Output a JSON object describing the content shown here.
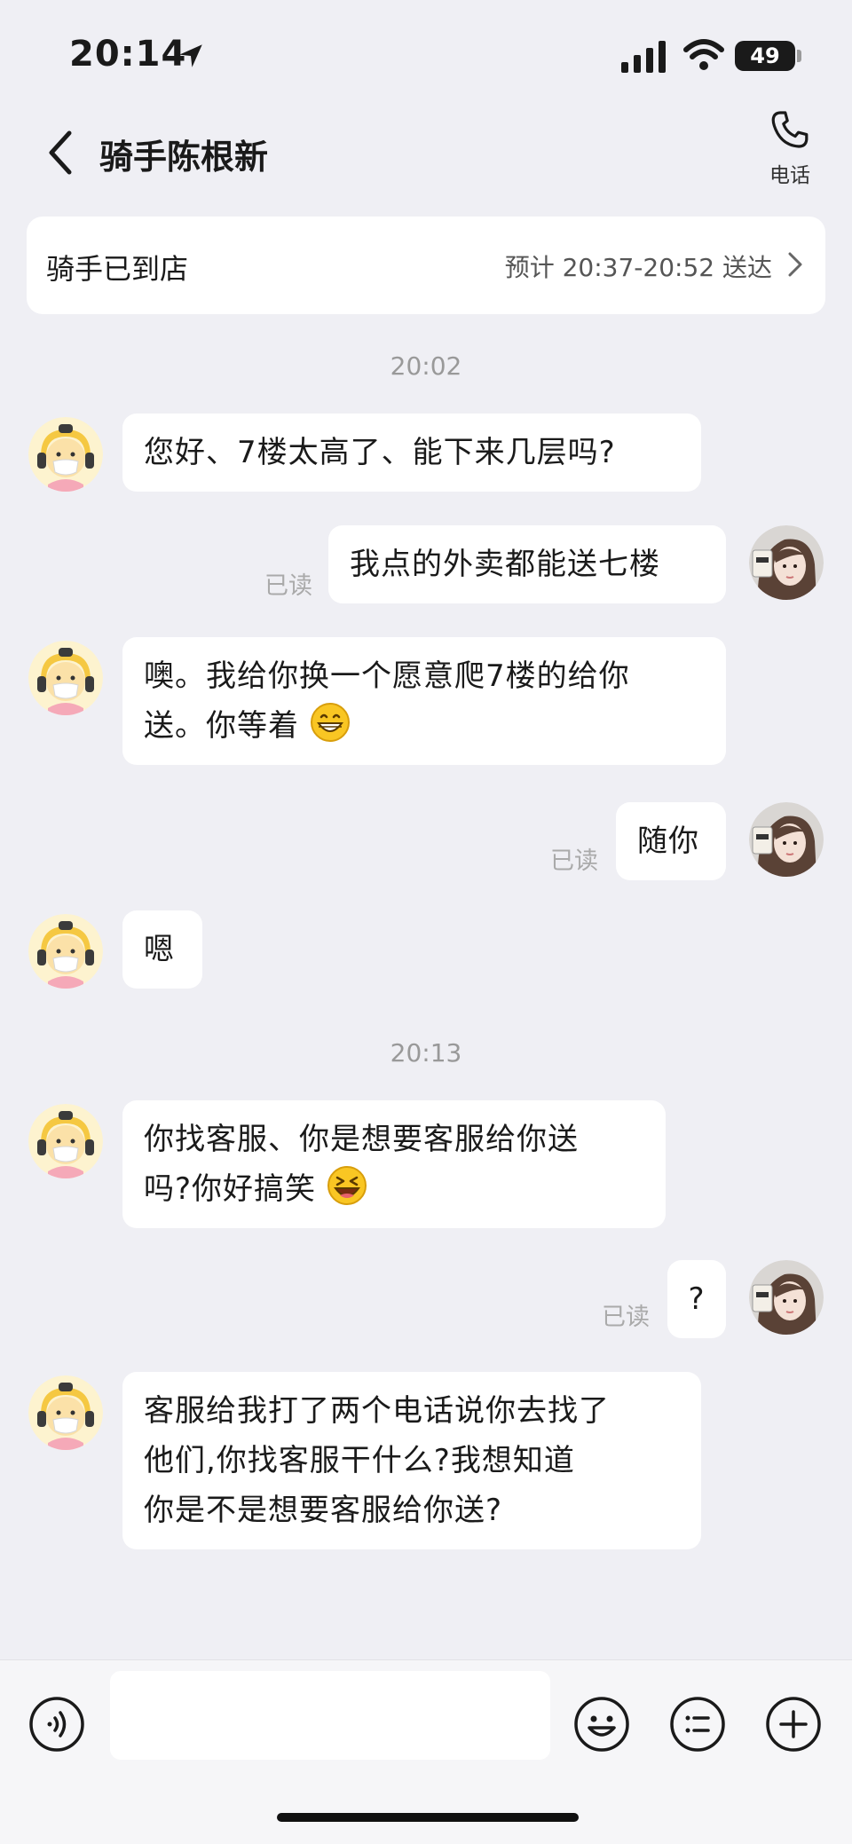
{
  "status_bar": {
    "time": "20:14",
    "battery": "49"
  },
  "header": {
    "title": "骑手陈根新",
    "call_label": "电话"
  },
  "order": {
    "status": "骑手已到店",
    "eta": "预计 20:37-20:52 送达"
  },
  "timestamps": [
    "20:02",
    "20:13"
  ],
  "messages": [
    {
      "from": "rider",
      "text": "您好、7楼太高了、能下来几层吗?"
    },
    {
      "from": "me",
      "text": "我点的外卖都能送七楼",
      "status": "已读"
    },
    {
      "from": "rider",
      "lines": [
        "噢。我给你换一个愿意爬7楼的给你",
        "送。你等着"
      ],
      "emoji": "grin"
    },
    {
      "from": "me",
      "text": "随你",
      "status": "已读"
    },
    {
      "from": "rider",
      "text": "嗯"
    },
    {
      "from": "rider",
      "lines": [
        "你找客服、你是想要客服给你送",
        "吗?你好搞笑"
      ],
      "emoji": "laugh"
    },
    {
      "from": "me",
      "text": "?",
      "status": "已读"
    },
    {
      "from": "rider",
      "lines": [
        "客服给我打了两个电话说你去找了",
        "他们,你找客服干什么?我想知道",
        "你是不是想要客服给你送?"
      ]
    }
  ],
  "input_bar": {
    "placeholder": ""
  },
  "icons": [
    "location-arrow-icon",
    "signal-icon",
    "wifi-icon",
    "back-chevron-icon",
    "phone-icon",
    "chevron-right-icon",
    "voice-icon",
    "emoji-icon",
    "quick-reply-icon",
    "plus-icon"
  ]
}
